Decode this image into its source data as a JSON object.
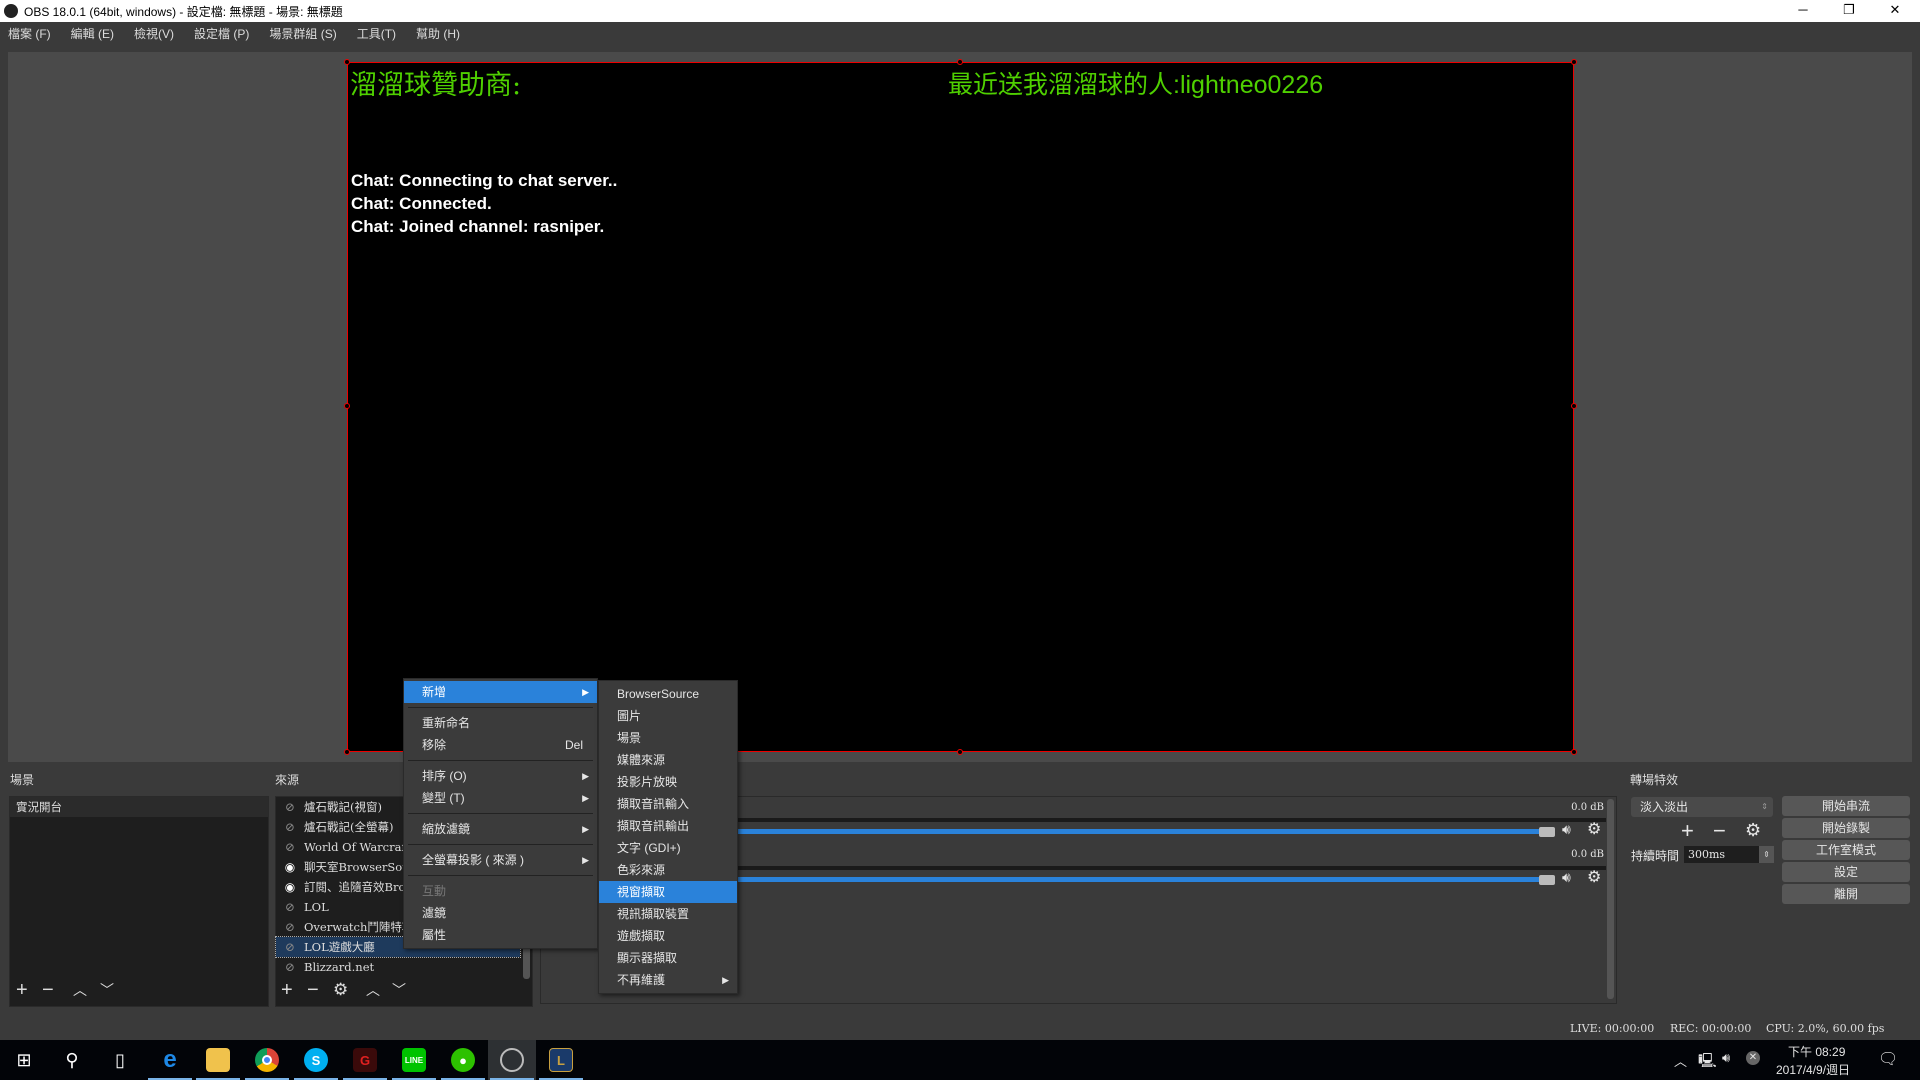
{
  "window": {
    "title": "OBS 18.0.1 (64bit, windows) - 設定檔: 無標題 - 場景: 無標題"
  },
  "menubar": [
    "檔案 (F)",
    "編輯 (E)",
    "檢視(V)",
    "設定檔 (P)",
    "場景群組 (S)",
    "工具(T)",
    "幫助 (H)"
  ],
  "preview": {
    "sponsor": "溜溜球贊助商:",
    "latest": "最近送我溜溜球的人:lightneo0226",
    "chat": [
      "Chat: Connecting to chat server..",
      "Chat: Connected.",
      "Chat: Joined channel: rasniper."
    ],
    "text_color": "#4fd000",
    "selection_color": "#ee0000"
  },
  "scenes": {
    "label": "場景",
    "items": [
      "實況開台"
    ]
  },
  "sources": {
    "label": "來源",
    "items": [
      {
        "name": "爐石戰記(視窗)",
        "visible": false
      },
      {
        "name": "爐石戰記(全螢幕)",
        "visible": false
      },
      {
        "name": "World Of Warcraft",
        "visible": false
      },
      {
        "name": "聊天室BrowserSource",
        "visible": true
      },
      {
        "name": "訂閱、追隨音效Browser",
        "visible": true
      },
      {
        "name": "LOL",
        "visible": false
      },
      {
        "name": "Overwatch鬥陣特攻",
        "visible": false
      },
      {
        "name": "LOL遊戲大廳",
        "visible": false,
        "selected": true
      },
      {
        "name": "Blizzard.net",
        "visible": false
      }
    ]
  },
  "context_menu": {
    "items": [
      {
        "label": "新增",
        "submenu": true,
        "highlighted": true
      },
      {
        "label": "重新命名"
      },
      {
        "label": "移除",
        "shortcut": "Del"
      },
      {
        "label": "排序 (O)",
        "submenu": true
      },
      {
        "label": "變型 (T)",
        "submenu": true
      },
      {
        "label": "縮放濾鏡",
        "submenu": true
      },
      {
        "label": "全螢幕投影 ( 來源 )",
        "submenu": true
      },
      {
        "label": "互動",
        "disabled": true
      },
      {
        "label": "濾鏡"
      },
      {
        "label": "屬性"
      }
    ]
  },
  "add_submenu": {
    "items": [
      "BrowserSource",
      "圖片",
      "場景",
      "媒體來源",
      "投影片放映",
      "擷取音訊輸入",
      "擷取音訊輸出",
      "文字 (GDI+)",
      "色彩來源",
      "視窗擷取",
      "視訊擷取裝置",
      "遊戲擷取",
      "顯示器擷取",
      "不再維護"
    ],
    "highlighted": "視窗擷取"
  },
  "mixer": {
    "channels": [
      {
        "db": "0.0 dB",
        "volume": 1.0
      },
      {
        "db": "0.0 dB",
        "volume": 1.0
      }
    ]
  },
  "transitions": {
    "label": "轉場特效",
    "selected": "淡入淡出",
    "duration_label": "持續時間",
    "duration": "300ms"
  },
  "controls": [
    "開始串流",
    "開始錄製",
    "工作室模式",
    "設定",
    "離開"
  ],
  "status": {
    "live": "LIVE: 00:00:00",
    "rec": "REC: 00:00:00",
    "cpu": "CPU: 2.0%, 60.00 fps"
  },
  "taskbar": {
    "time": "下午 08:29",
    "date": "2017/4/9/週日",
    "accent": "#2a82da"
  }
}
